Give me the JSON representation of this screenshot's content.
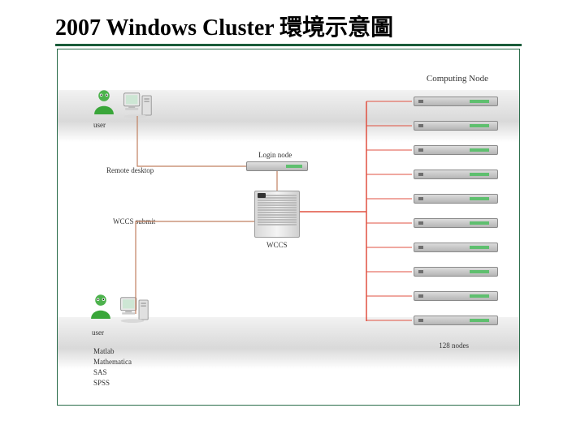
{
  "title": "2007 Windows Cluster 環境示意圖",
  "labels": {
    "user_top": "user",
    "user_bottom": "user",
    "remote_desktop": "Remote desktop",
    "wccs_submit": "WCCS submit",
    "login_node": "Login node",
    "wccs": "WCCS",
    "computing_node": "Computing Node",
    "node_count": "128 nodes"
  },
  "software_list": [
    "Matlab",
    "Mathematica",
    "SAS",
    "SPSS"
  ]
}
